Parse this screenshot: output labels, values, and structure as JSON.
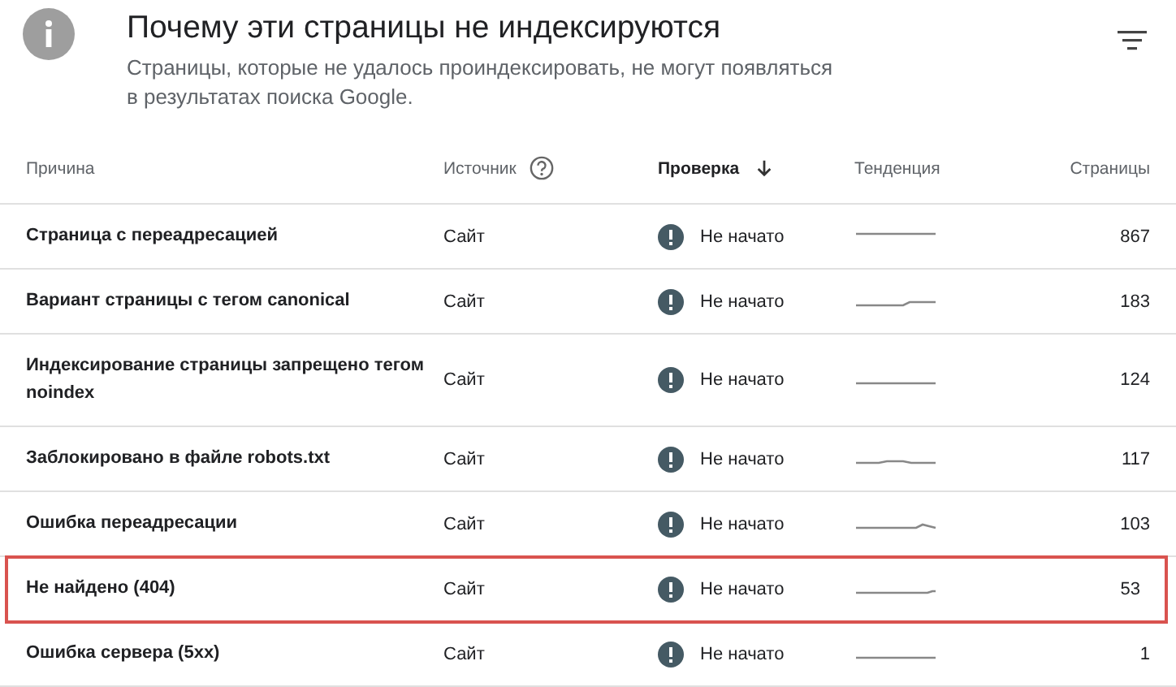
{
  "header": {
    "title": "Почему эти страницы не индексируются",
    "description": "Страницы, которые не удалось проиндексировать, не могут появляться в результатах поиска Google."
  },
  "table": {
    "columns": [
      {
        "label": "Причина",
        "help": false,
        "sorted": false
      },
      {
        "label": "Источник",
        "help": true,
        "sorted": false
      },
      {
        "label": "Проверка",
        "help": false,
        "sorted": true
      },
      {
        "label": "Тенденция",
        "help": false,
        "sorted": false
      },
      {
        "label": "Страницы",
        "help": false,
        "sorted": false
      }
    ],
    "rows": [
      {
        "reason": "Страница с переадресацией",
        "source": "Сайт",
        "status": "Не начато",
        "pages": "867",
        "highlighted": false
      },
      {
        "reason": "Вариант страницы с тегом canonical",
        "source": "Сайт",
        "status": "Не начато",
        "pages": "183",
        "highlighted": false
      },
      {
        "reason": "Индексирование страницы запрещено тегом noindex",
        "source": "Сайт",
        "status": "Не начато",
        "pages": "124",
        "highlighted": false
      },
      {
        "reason": "Заблокировано в файле robots.txt",
        "source": "Сайт",
        "status": "Не начато",
        "pages": "117",
        "highlighted": false
      },
      {
        "reason": "Ошибка переадресации",
        "source": "Сайт",
        "status": "Не начато",
        "pages": "103",
        "highlighted": false
      },
      {
        "reason": "Не найдено (404)",
        "source": "Сайт",
        "status": "Не начато",
        "pages": "53",
        "highlighted": true
      },
      {
        "reason": "Ошибка сервера (5xx)",
        "source": "Сайт",
        "status": "Не начато",
        "pages": "1",
        "highlighted": false
      }
    ]
  }
}
